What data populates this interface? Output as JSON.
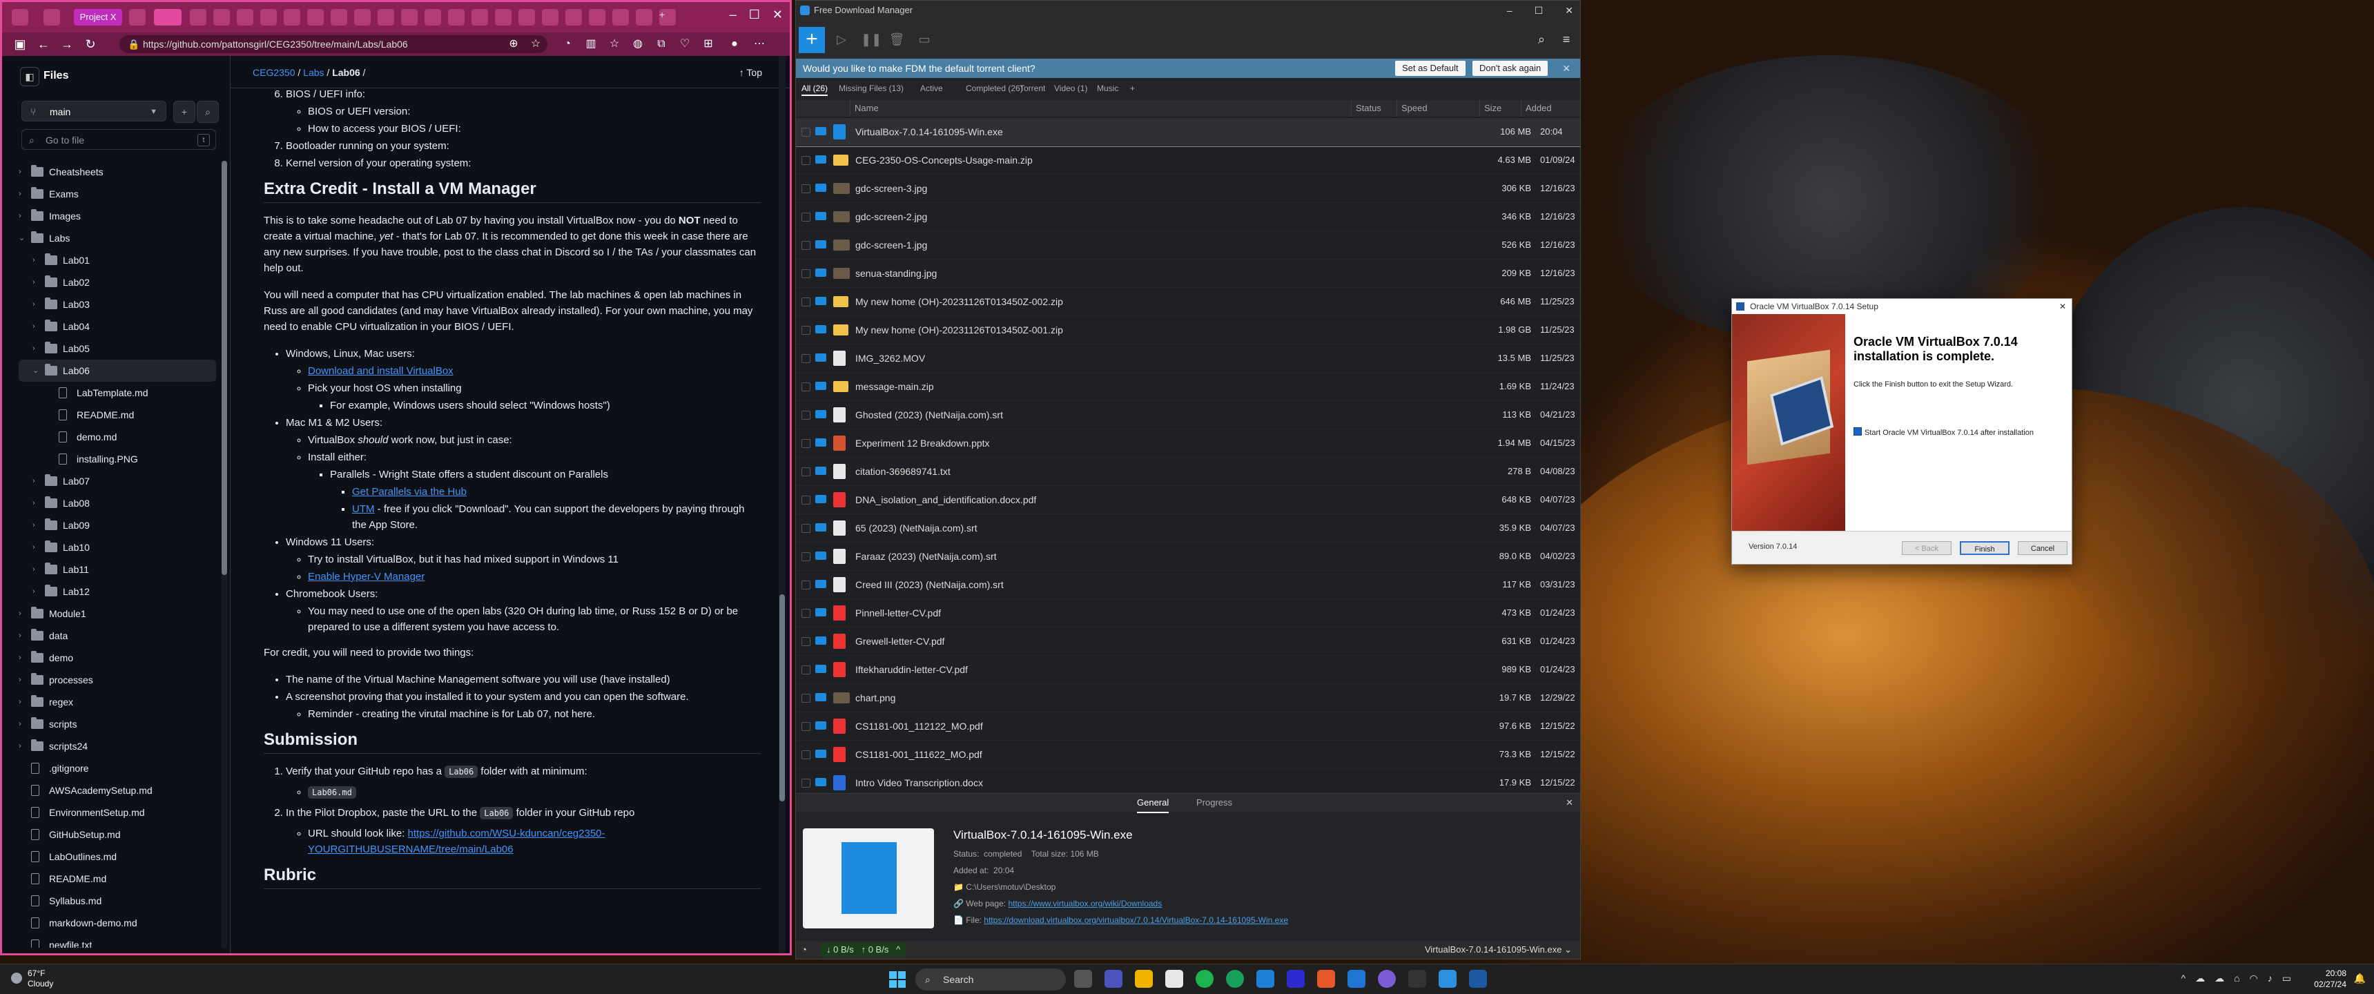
{
  "browser": {
    "url": "https://github.com/pattonsgirl/CEG2350/tree/main/Labs/Lab06",
    "tab_label": "Project X"
  },
  "github": {
    "files_title": "Files",
    "branch": "main",
    "goto_placeholder": "Go to file",
    "goto_key": "t",
    "tree": [
      {
        "label": "Cheatsheets",
        "type": "folder",
        "depth": 0,
        "expanded": false
      },
      {
        "label": "Exams",
        "type": "folder",
        "depth": 0,
        "expanded": false
      },
      {
        "label": "Images",
        "type": "folder",
        "depth": 0,
        "expanded": false
      },
      {
        "label": "Labs",
        "type": "folder",
        "depth": 0,
        "expanded": true
      },
      {
        "label": "Lab01",
        "type": "folder",
        "depth": 1,
        "expanded": false
      },
      {
        "label": "Lab02",
        "type": "folder",
        "depth": 1,
        "expanded": false
      },
      {
        "label": "Lab03",
        "type": "folder",
        "depth": 1,
        "expanded": false
      },
      {
        "label": "Lab04",
        "type": "folder",
        "depth": 1,
        "expanded": false
      },
      {
        "label": "Lab05",
        "type": "folder",
        "depth": 1,
        "expanded": false
      },
      {
        "label": "Lab06",
        "type": "folder",
        "depth": 1,
        "expanded": true,
        "selected": true
      },
      {
        "label": "LabTemplate.md",
        "type": "file",
        "depth": 2
      },
      {
        "label": "README.md",
        "type": "file",
        "depth": 2
      },
      {
        "label": "demo.md",
        "type": "file",
        "depth": 2
      },
      {
        "label": "installing.PNG",
        "type": "file",
        "depth": 2
      },
      {
        "label": "Lab07",
        "type": "folder",
        "depth": 1,
        "expanded": false
      },
      {
        "label": "Lab08",
        "type": "folder",
        "depth": 1,
        "expanded": false
      },
      {
        "label": "Lab09",
        "type": "folder",
        "depth": 1,
        "expanded": false
      },
      {
        "label": "Lab10",
        "type": "folder",
        "depth": 1,
        "expanded": false
      },
      {
        "label": "Lab11",
        "type": "folder",
        "depth": 1,
        "expanded": false
      },
      {
        "label": "Lab12",
        "type": "folder",
        "depth": 1,
        "expanded": false
      },
      {
        "label": "Module1",
        "type": "folder",
        "depth": 0,
        "expanded": false
      },
      {
        "label": "data",
        "type": "folder",
        "depth": 0,
        "expanded": false
      },
      {
        "label": "demo",
        "type": "folder",
        "depth": 0,
        "expanded": false
      },
      {
        "label": "processes",
        "type": "folder",
        "depth": 0,
        "expanded": false
      },
      {
        "label": "regex",
        "type": "folder",
        "depth": 0,
        "expanded": false
      },
      {
        "label": "scripts",
        "type": "folder",
        "depth": 0,
        "expanded": false
      },
      {
        "label": "scripts24",
        "type": "folder",
        "depth": 0,
        "expanded": false
      },
      {
        "label": ".gitignore",
        "type": "file",
        "depth": 0
      },
      {
        "label": "AWSAcademySetup.md",
        "type": "file",
        "depth": 0
      },
      {
        "label": "EnvironmentSetup.md",
        "type": "file",
        "depth": 0
      },
      {
        "label": "GitHubSetup.md",
        "type": "file",
        "depth": 0
      },
      {
        "label": "LabOutlines.md",
        "type": "file",
        "depth": 0
      },
      {
        "label": "README.md",
        "type": "file",
        "depth": 0
      },
      {
        "label": "Syllabus.md",
        "type": "file",
        "depth": 0
      },
      {
        "label": "markdown-demo.md",
        "type": "file",
        "depth": 0
      },
      {
        "label": "newfile.txt",
        "type": "file",
        "depth": 0
      }
    ],
    "breadcrumb": {
      "repo": "CEG2350",
      "sep": "/",
      "labs": "Labs",
      "current": "Lab06",
      "trailing": "/"
    },
    "top_label": "Top",
    "article": {
      "partial_item": "BIOS / UEFI info:",
      "bios_sub1": "BIOS or UEFI version:",
      "bios_sub2": "How to access your BIOS / UEFI:",
      "item7": "Bootloader running on your system:",
      "item8": "Kernel version of your operating system:",
      "h_extra": "Extra Credit - Install a VM Manager",
      "p1_a": "This is to take some headache out of Lab 07 by having you install VirtualBox now - you do ",
      "p1_not": "NOT",
      "p1_b": " need to create a virtual machine, ",
      "p1_yet": "yet",
      "p1_c": " - that's for Lab 07. It is recommended to get done this week in case there are any new surprises. If you have trouble, post to the class chat in Discord so I / the TAs / your classmates can help out.",
      "p2": "You will need a computer that has CPU virtualization enabled. The lab machines & open lab machines in Russ are all good candidates (and may have VirtualBox already installed). For your own machine, you may need to enable CPU virtualization in your BIOS / UEFI.",
      "win_title": "Windows, Linux, Mac users:",
      "win_link": "Download and install VirtualBox",
      "win_pick": "Pick your host OS when installing",
      "win_example": "For example, Windows users should select \"Windows hosts\")",
      "mac_title": "Mac M1 & M2 Users:",
      "mac_vb_a": "VirtualBox ",
      "mac_vb_should": "should",
      "mac_vb_b": " work now, but just in case:",
      "mac_install": "Install either:",
      "mac_parallels": "Parallels - Wright State offers a student discount on Parallels",
      "mac_parallels_link": "Get Parallels via the Hub",
      "mac_utm_link": "UTM",
      "mac_utm_text": " - free if you click \"Download\". You can support the developers by paying through the App Store.",
      "w11_title": "Windows 11 Users:",
      "w11_text": "Try to install VirtualBox, but it has had mixed support in Windows 11",
      "w11_link": "Enable Hyper-V Manager",
      "cb_title": "Chromebook Users:",
      "cb_text": "You may need to use one of the open labs (320 OH during lab time, or Russ 152 B or D) or be prepared to use a different system you have access to.",
      "credit": "For credit, you will need to provide two things:",
      "credit1": "The name of the Virtual Machine Management software you will use (have installed)",
      "credit2": "A screenshot proving that you installed it to your system and you can open the software.",
      "credit2_sub": "Reminder - creating the virutal machine is for Lab 07, not here.",
      "h_sub": "Submission",
      "sub1_a": "Verify that your GitHub repo has a ",
      "sub1_code": "Lab06",
      "sub1_b": " folder with at minimum:",
      "sub1_file": "Lab06.md",
      "sub2_a": "In the Pilot Dropbox, paste the URL to the ",
      "sub2_code": "Lab06",
      "sub2_b": " folder in your GitHub repo",
      "sub2_url_a": "URL should look like: ",
      "sub2_url": "https://github.com/WSU-kduncan/ceg2350-YOURGITHUBUSERNAME/tree/main/Lab06",
      "h_rubric": "Rubric"
    }
  },
  "fdm": {
    "title": "Free Download Manager",
    "banner_text": "Would you like to make FDM the default torrent client?",
    "banner_yes": "Set as Default",
    "banner_no": "Don't ask again",
    "tabs": [
      "All (26)",
      "Missing Files (13)",
      "Active",
      "Completed (26)",
      "Torrent",
      "Video (1)",
      "Music",
      "+"
    ],
    "columns": {
      "name": "Name",
      "status": "Status",
      "speed": "Speed",
      "size": "Size",
      "added": "Added"
    },
    "downloads": [
      {
        "name": "VirtualBox-7.0.14-161095-Win.exe",
        "size": "106 MB",
        "added": "20:04",
        "kind": "exe",
        "selected": true
      },
      {
        "name": "CEG-2350-OS-Concepts-Usage-main.zip",
        "size": "4.63 MB",
        "added": "01/09/24",
        "kind": "zip"
      },
      {
        "name": "gdc-screen-3.jpg",
        "size": "306 KB",
        "added": "12/16/23",
        "kind": "img"
      },
      {
        "name": "gdc-screen-2.jpg",
        "size": "346 KB",
        "added": "12/16/23",
        "kind": "img"
      },
      {
        "name": "gdc-screen-1.jpg",
        "size": "526 KB",
        "added": "12/16/23",
        "kind": "img"
      },
      {
        "name": "senua-standing.jpg",
        "size": "209 KB",
        "added": "12/16/23",
        "kind": "img"
      },
      {
        "name": "My new home (OH)-20231126T013450Z-002.zip",
        "size": "646 MB",
        "added": "11/25/23",
        "kind": "zip"
      },
      {
        "name": "My new home (OH)-20231126T013450Z-001.zip",
        "size": "1.98 GB",
        "added": "11/25/23",
        "kind": "zip"
      },
      {
        "name": "IMG_3262.MOV",
        "size": "13.5 MB",
        "added": "11/25/23",
        "kind": "file"
      },
      {
        "name": "message-main.zip",
        "size": "1.69 KB",
        "added": "11/24/23",
        "kind": "zip"
      },
      {
        "name": "Ghosted (2023) (NetNaija.com).srt",
        "size": "113 KB",
        "added": "04/21/23",
        "kind": "file"
      },
      {
        "name": "Experiment 12 Breakdown.pptx",
        "size": "1.94 MB",
        "added": "04/15/23",
        "kind": "ppt"
      },
      {
        "name": "citation-369689741.txt",
        "size": "278 B",
        "added": "04/08/23",
        "kind": "file"
      },
      {
        "name": "DNA_isolation_and_identification.docx.pdf",
        "size": "648 KB",
        "added": "04/07/23",
        "kind": "pdf"
      },
      {
        "name": "65 (2023) (NetNaija.com).srt",
        "size": "35.9 KB",
        "added": "04/07/23",
        "kind": "file"
      },
      {
        "name": "Faraaz (2023) (NetNaija.com).srt",
        "size": "89.0 KB",
        "added": "04/02/23",
        "kind": "file"
      },
      {
        "name": "Creed III (2023) (NetNaija.com).srt",
        "size": "117 KB",
        "added": "03/31/23",
        "kind": "file"
      },
      {
        "name": "Pinnell-letter-CV.pdf",
        "size": "473 KB",
        "added": "01/24/23",
        "kind": "pdf"
      },
      {
        "name": "Grewell-letter-CV.pdf",
        "size": "631 KB",
        "added": "01/24/23",
        "kind": "pdf"
      },
      {
        "name": "Iftekharuddin-letter-CV.pdf",
        "size": "989 KB",
        "added": "01/24/23",
        "kind": "pdf"
      },
      {
        "name": "chart.png",
        "size": "19.7 KB",
        "added": "12/29/22",
        "kind": "img"
      },
      {
        "name": "CS1181-001_112122_MO.pdf",
        "size": "97.6 KB",
        "added": "12/15/22",
        "kind": "pdf"
      },
      {
        "name": "CS1181-001_111622_MO.pdf",
        "size": "73.3 KB",
        "added": "12/15/22",
        "kind": "pdf"
      },
      {
        "name": "Intro Video Transcription.docx",
        "size": "17.9 KB",
        "added": "12/15/22",
        "kind": "doc"
      }
    ],
    "details": {
      "tab_general": "General",
      "tab_progress": "Progress",
      "filename": "VirtualBox-7.0.14-161095-Win.exe",
      "status_label": "Status:",
      "status_value": "completed",
      "total_label": "Total size:",
      "total_value": "106 MB",
      "added_label": "Added at:",
      "added_value": "20:04",
      "path": "C:\\Users\\motuv\\Desktop",
      "webpage_label": "Web page:",
      "webpage_value": "https://www.virtualbox.org/wiki/Downloads",
      "file_label": "File:",
      "file_value": "https://download.virtualbox.org/virtualbox/7.0.14/VirtualBox-7.0.14-161095-Win.exe"
    },
    "status_bar": {
      "down": "↓ 0 B/s",
      "up": "↑ 0 B/s",
      "right": "VirtualBox-7.0.14-161095-Win.exe"
    }
  },
  "vbox": {
    "title": "Oracle VM VirtualBox 7.0.14 Setup",
    "heading": "Oracle VM VirtualBox 7.0.14 installation is complete.",
    "sub": "Click the Finish button to exit the Setup Wizard.",
    "checkbox": "Start Oracle VM VirtualBox 7.0.14 after installation",
    "version": "Version 7.0.14",
    "back": "< Back",
    "finish": "Finish",
    "cancel": "Cancel"
  },
  "taskbar": {
    "weather_temp": "67°F",
    "weather_desc": "Cloudy",
    "search": "Search",
    "time": "20:08",
    "date": "02/27/24"
  }
}
